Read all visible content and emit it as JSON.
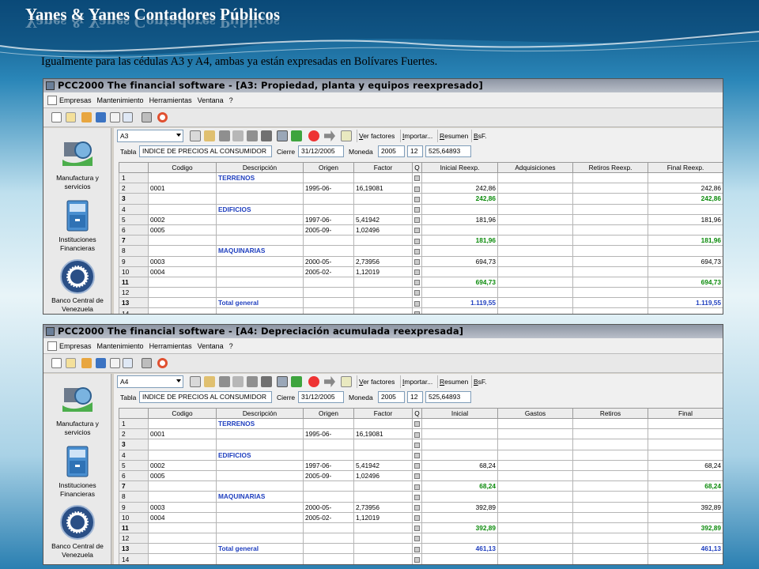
{
  "slide": {
    "title": "Yanes & Yanes Contadores Públicos",
    "subtitle": "Igualmente para las cédulas A3 y A4, ambas  ya están expresadas en Bolívares Fuertes."
  },
  "colors": {
    "section_blue": "#1f3fbf",
    "total_green": "#0a8a0a"
  },
  "menu": [
    "Empresas",
    "Mantenimiento",
    "Herramientas",
    "Ventana",
    "?"
  ],
  "toolbar": {
    "ver_factores": "Ver factores",
    "importar": "Importar...",
    "resumen": "Resumen",
    "bsf": "BsF."
  },
  "params": {
    "tabla_label": "Tabla",
    "tabla_value": "INDICE DE PRECIOS AL CONSUMIDOR",
    "cierre_label": "Cierre",
    "cierre_value": "31/12/2005",
    "moneda_label": "Moneda",
    "moneda_year": "2005",
    "moneda_month": "12",
    "moneda_index": "525,64893"
  },
  "left_panel": [
    {
      "label": "Manufactura y servicios",
      "icon": "manufactura-icon"
    },
    {
      "label": "Instituciones Financieras",
      "icon": "filing-cabinet-icon"
    },
    {
      "label": "Banco Central de Venezuela",
      "icon": "bcv-seal-icon"
    }
  ],
  "windows": [
    {
      "title": "PCC2000 The financial software - [A3: Propiedad, planta y equipos reexpresado]",
      "combo": "A3",
      "columns": [
        "",
        "Codigo",
        "Descripción",
        "Origen",
        "Factor",
        "Q",
        "Inicial Reexp.",
        "Adquisiciones",
        "Retiros Reexp.",
        "Final Reexp."
      ],
      "rows": [
        {
          "n": "1",
          "codigo": "",
          "desc": "TERRENOS",
          "origen": "",
          "factor": "",
          "c1": "",
          "c2": "",
          "c3": "",
          "c4": "",
          "kind": "section"
        },
        {
          "n": "2",
          "codigo": "0001",
          "desc": "",
          "origen": "1995-06-",
          "factor": "16,19081",
          "c1": "242,86",
          "c2": "",
          "c3": "",
          "c4": "242,86",
          "kind": "item"
        },
        {
          "n": "3",
          "codigo": "",
          "desc": "",
          "origen": "",
          "factor": "",
          "c1": "242,86",
          "c2": "",
          "c3": "",
          "c4": "242,86",
          "kind": "total"
        },
        {
          "n": "4",
          "codigo": "",
          "desc": "EDIFICIOS",
          "origen": "",
          "factor": "",
          "c1": "",
          "c2": "",
          "c3": "",
          "c4": "",
          "kind": "section"
        },
        {
          "n": "5",
          "codigo": "0002",
          "desc": "",
          "origen": "1997-06-",
          "factor": "5,41942",
          "c1": "181,96",
          "c2": "",
          "c3": "",
          "c4": "181,96",
          "kind": "item"
        },
        {
          "n": "6",
          "codigo": "0005",
          "desc": "",
          "origen": "2005-09-",
          "factor": "1,02496",
          "c1": "",
          "c2": "",
          "c3": "",
          "c4": "",
          "kind": "item"
        },
        {
          "n": "7",
          "codigo": "",
          "desc": "",
          "origen": "",
          "factor": "",
          "c1": "181,96",
          "c2": "",
          "c3": "",
          "c4": "181,96",
          "kind": "total"
        },
        {
          "n": "8",
          "codigo": "",
          "desc": "MAQUINARIAS",
          "origen": "",
          "factor": "",
          "c1": "",
          "c2": "",
          "c3": "",
          "c4": "",
          "kind": "section"
        },
        {
          "n": "9",
          "codigo": "0003",
          "desc": "",
          "origen": "2000-05-",
          "factor": "2,73956",
          "c1": "694,73",
          "c2": "",
          "c3": "",
          "c4": "694,73",
          "kind": "item"
        },
        {
          "n": "10",
          "codigo": "0004",
          "desc": "",
          "origen": "2005-02-",
          "factor": "1,12019",
          "c1": "",
          "c2": "",
          "c3": "",
          "c4": "",
          "kind": "item"
        },
        {
          "n": "11",
          "codigo": "",
          "desc": "",
          "origen": "",
          "factor": "",
          "c1": "694,73",
          "c2": "",
          "c3": "",
          "c4": "694,73",
          "kind": "total"
        },
        {
          "n": "12",
          "codigo": "",
          "desc": "",
          "origen": "",
          "factor": "",
          "c1": "",
          "c2": "",
          "c3": "",
          "c4": "",
          "kind": "item"
        },
        {
          "n": "13",
          "codigo": "",
          "desc": "Total general",
          "origen": "",
          "factor": "",
          "c1": "1.119,55",
          "c2": "",
          "c3": "",
          "c4": "1.119,55",
          "kind": "grand"
        },
        {
          "n": "14",
          "codigo": "",
          "desc": "",
          "origen": "",
          "factor": "",
          "c1": "",
          "c2": "",
          "c3": "",
          "c4": "",
          "kind": "item"
        }
      ]
    },
    {
      "title": "PCC2000 The financial software - [A4: Depreciación acumulada reexpresada]",
      "combo": "A4",
      "columns": [
        "",
        "Codigo",
        "Descripción",
        "Origen",
        "Factor",
        "Q",
        "Inicial",
        "Gastos",
        "Retiros",
        "Final"
      ],
      "rows": [
        {
          "n": "1",
          "codigo": "",
          "desc": "TERRENOS",
          "origen": "",
          "factor": "",
          "c1": "",
          "c2": "",
          "c3": "",
          "c4": "",
          "kind": "section"
        },
        {
          "n": "2",
          "codigo": "0001",
          "desc": "",
          "origen": "1995-06-",
          "factor": "16,19081",
          "c1": "",
          "c2": "",
          "c3": "",
          "c4": "",
          "kind": "item"
        },
        {
          "n": "3",
          "codigo": "",
          "desc": "",
          "origen": "",
          "factor": "",
          "c1": "",
          "c2": "",
          "c3": "",
          "c4": "",
          "kind": "total"
        },
        {
          "n": "4",
          "codigo": "",
          "desc": "EDIFICIOS",
          "origen": "",
          "factor": "",
          "c1": "",
          "c2": "",
          "c3": "",
          "c4": "",
          "kind": "section"
        },
        {
          "n": "5",
          "codigo": "0002",
          "desc": "",
          "origen": "1997-06-",
          "factor": "5,41942",
          "c1": "68,24",
          "c2": "",
          "c3": "",
          "c4": "68,24",
          "kind": "item"
        },
        {
          "n": "6",
          "codigo": "0005",
          "desc": "",
          "origen": "2005-09-",
          "factor": "1,02496",
          "c1": "",
          "c2": "",
          "c3": "",
          "c4": "",
          "kind": "item"
        },
        {
          "n": "7",
          "codigo": "",
          "desc": "",
          "origen": "",
          "factor": "",
          "c1": "68,24",
          "c2": "",
          "c3": "",
          "c4": "68,24",
          "kind": "total"
        },
        {
          "n": "8",
          "codigo": "",
          "desc": "MAQUINARIAS",
          "origen": "",
          "factor": "",
          "c1": "",
          "c2": "",
          "c3": "",
          "c4": "",
          "kind": "section"
        },
        {
          "n": "9",
          "codigo": "0003",
          "desc": "",
          "origen": "2000-05-",
          "factor": "2,73956",
          "c1": "392,89",
          "c2": "",
          "c3": "",
          "c4": "392,89",
          "kind": "item"
        },
        {
          "n": "10",
          "codigo": "0004",
          "desc": "",
          "origen": "2005-02-",
          "factor": "1,12019",
          "c1": "",
          "c2": "",
          "c3": "",
          "c4": "",
          "kind": "item"
        },
        {
          "n": "11",
          "codigo": "",
          "desc": "",
          "origen": "",
          "factor": "",
          "c1": "392,89",
          "c2": "",
          "c3": "",
          "c4": "392,89",
          "kind": "total"
        },
        {
          "n": "12",
          "codigo": "",
          "desc": "",
          "origen": "",
          "factor": "",
          "c1": "",
          "c2": "",
          "c3": "",
          "c4": "",
          "kind": "item"
        },
        {
          "n": "13",
          "codigo": "",
          "desc": "Total general",
          "origen": "",
          "factor": "",
          "c1": "461,13",
          "c2": "",
          "c3": "",
          "c4": "461,13",
          "kind": "grand"
        },
        {
          "n": "14",
          "codigo": "",
          "desc": "",
          "origen": "",
          "factor": "",
          "c1": "",
          "c2": "",
          "c3": "",
          "c4": "",
          "kind": "item"
        }
      ]
    }
  ]
}
